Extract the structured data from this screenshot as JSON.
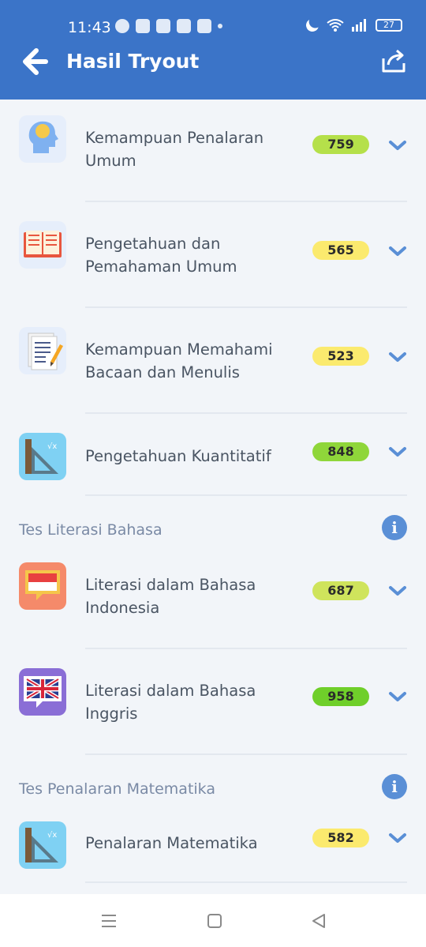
{
  "status": {
    "time": "11:43",
    "battery": "27"
  },
  "header": {
    "title": "Hasil Tryout",
    "back_icon": "arrow-left-icon",
    "share_icon": "share-icon"
  },
  "items": [
    {
      "label": "Kemampuan Penalaran Umum",
      "score": "759",
      "score_color": "#b5e04a",
      "icon": "head-brain-icon"
    },
    {
      "label": "Pengetahuan dan Pemahaman Umum",
      "score": "565",
      "score_color": "#fbea6e",
      "icon": "open-book-icon"
    },
    {
      "label": "Kemampuan Memahami Bacaan dan Menulis",
      "score": "523",
      "score_color": "#fbea6e",
      "icon": "document-pencil-icon"
    },
    {
      "label": "Pengetahuan Kuantitatif",
      "score": "848",
      "score_color": "#8fd63a",
      "icon": "ruler-math-icon"
    }
  ],
  "sections": [
    {
      "title": "Tes Literasi Bahasa",
      "items": [
        {
          "label": "Literasi dalam Bahasa Indonesia",
          "score": "687",
          "score_color": "#cfe45c",
          "icon": "indonesia-flag-chat-icon"
        },
        {
          "label": "Literasi dalam Bahasa Inggris",
          "score": "958",
          "score_color": "#6fcf2a",
          "icon": "uk-flag-chat-icon"
        }
      ]
    },
    {
      "title": "Tes Penalaran Matematika",
      "items": [
        {
          "label": "Penalaran Matematika",
          "score": "582",
          "score_color": "#fbea6e",
          "icon": "ruler-math-icon"
        }
      ]
    }
  ]
}
